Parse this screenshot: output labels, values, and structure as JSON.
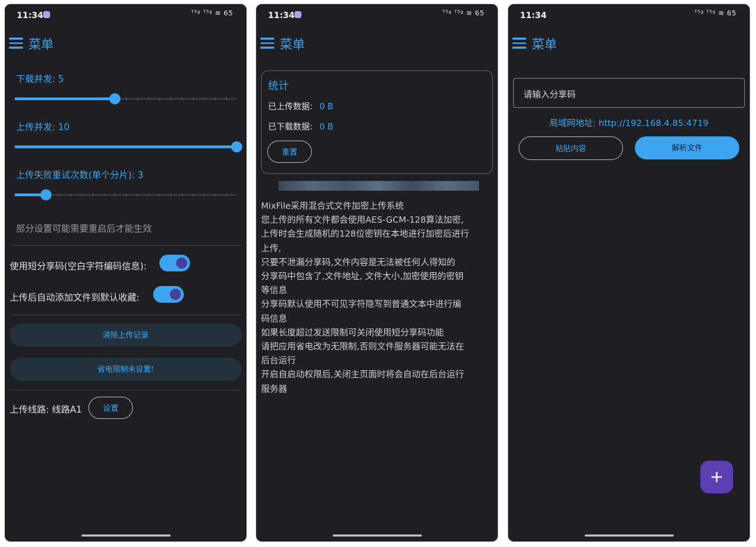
{
  "status": {
    "time": "11:34",
    "signal": "ᵀ⁵ᵍ ᵀ⁵ᵍ ≋ 65"
  },
  "appbar": {
    "title": "菜单"
  },
  "settings": {
    "download_concurrency": "下载并发: 5",
    "download_concurrency_value": 0.45,
    "upload_concurrency": "上传并发: 10",
    "upload_concurrency_value": 1.0,
    "upload_retry": "上传失败重试次数(单个分片): 3",
    "upload_retry_value": 0.14,
    "restart_hint": "部分设置可能需要重启后才能生效",
    "short_code_label": "使用短分享码(空白字符编码信息):",
    "short_code_on": true,
    "auto_fav_label": "上传后自动添加文件到默认收藏:",
    "auto_fav_on": true,
    "clear_button": "清除上传记录",
    "battery_button": "省电限制未设置!",
    "route_label": "上传线路: 线路A1",
    "route_button": "设置"
  },
  "stats": {
    "title": "统计",
    "uploaded_label": "已上传数据:",
    "uploaded_value": "0 B",
    "downloaded_label": "已下载数据:",
    "downloaded_value": "0 B",
    "reset_button": "重置"
  },
  "description": [
    "MixFile采用混合式文件加密上传系统",
    "您上传的所有文件都会使用AES-GCM-128算法加密,",
    "上传时会生成随机的128位密钥在本地进行加密后进行",
    "上传,",
    "只要不泄漏分享码,文件内容是无法被任何人得知的",
    "分享码中包含了,文件地址, 文件大小,加密使用的密钥",
    "等信息",
    "分享码默认使用不可见字符隐写到普通文本中进行编",
    "码信息",
    "如果长度超过发送限制可关闭使用短分享码功能",
    "请把应用省电改为无限制,否则文件服务器可能无法在",
    "后台运行",
    "开启自启动权限后,关闭主页面时将会自动在后台运行",
    "服务器"
  ],
  "share": {
    "input_placeholder": "请输入分享码",
    "lan_address": "局域网地址: http://192.168.4.85:4719",
    "paste_button": "粘贴内容",
    "parse_button": "解析文件",
    "fab": "+"
  },
  "colors": {
    "accent": "#3da5f0",
    "background": "#1f1f23",
    "fab": "#5b3fb0"
  }
}
